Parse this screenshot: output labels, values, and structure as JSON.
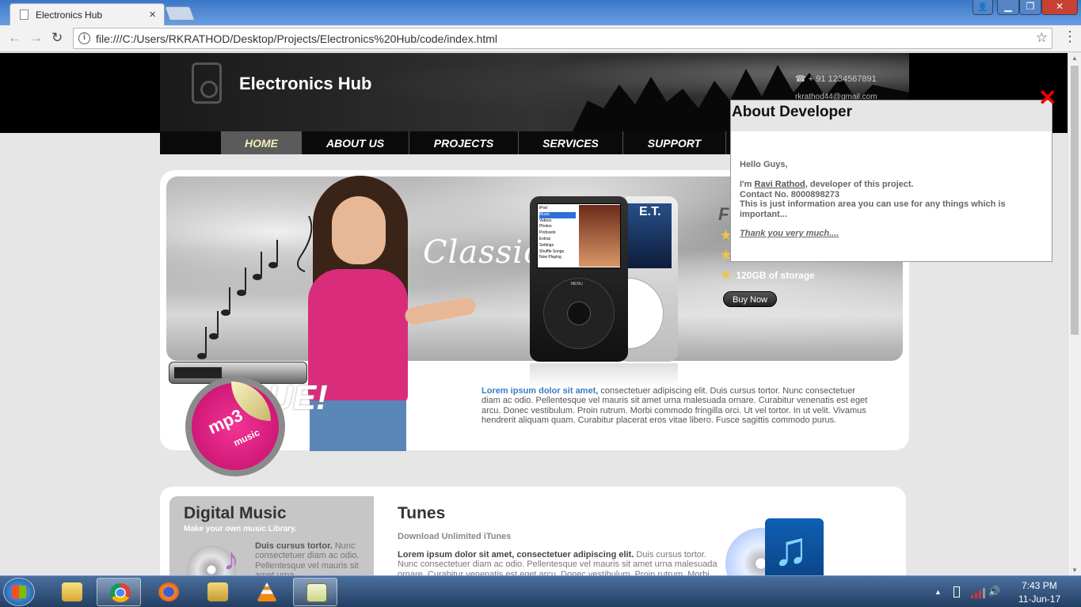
{
  "browser": {
    "tab_title": "Electronics Hub",
    "tab_close": "×",
    "url": "file:///C:/Users/RKRATHOD/Desktop/Projects/Electronics%20Hub/code/index.html",
    "back": "←",
    "forward": "→",
    "reload": "↻",
    "star": "☆",
    "menu": "⋮",
    "info_glyph": "i"
  },
  "window_controls": {
    "minimize": "▁",
    "maximize": "❐",
    "close": "✕",
    "user": "👤"
  },
  "header": {
    "site_title": "Electronics Hub",
    "phone": "☎   + 91 1234567891",
    "email": "rkrathod44@gmail.com"
  },
  "nav": {
    "items": [
      {
        "label": "HOME"
      },
      {
        "label": "ABOUT US"
      },
      {
        "label": "PROJECTS"
      },
      {
        "label": "SERVICES"
      },
      {
        "label": "SUPPORT"
      }
    ]
  },
  "banner": {
    "classic_script": "Classic",
    "feature_heading": "F",
    "features": [
      "",
      "",
      "120GB of storage"
    ],
    "buy_now": "Buy Now",
    "ipod_menu": [
      "iPod",
      "Music",
      "Videos",
      "Photos",
      "Podcasts",
      "Extras",
      "Settings",
      "Shuffle Songs",
      "Now Playing"
    ],
    "ipod_wheel_label": "MENU",
    "ipod_silver_title": "E.T.",
    "sticker_mp3": "mp3",
    "sticker_music": "music",
    "big_text": "UE!",
    "lorem_lead": "Lorem ipsum dolor sit amet,",
    "lorem_body": " consectetuer adipiscing elit. Duis cursus tortor. Nunc consectetuer diam ac odio. Pellentesque vel mauris sit amet urna malesuada ornare. Curabitur venenatis est eget arcu. Donec vestibulum. Proin rutrum. Morbi commodo fringilla orci. Ut vel tortor. In ut velit. Vivamus hendrerit aliquam quam. Curabitur placerat eros vitae libero. Fusce sagittis commodo purus."
  },
  "digital_music": {
    "heading": "Digital Music",
    "subheading": "Make your own music Library.",
    "text_lead": "Duis cursus tortor.",
    "text_body": " Nunc consectetuer diam ac odio. Pellentesque vel mauris sit amet urna"
  },
  "tunes": {
    "heading": "Tunes",
    "subheading": "Download Unlimited iTunes",
    "text_lead": "Lorem ipsum dolor sit amet, consectetuer adipiscing elit.",
    "text_body": " Duis cursus tortor. Nunc consectetuer diam ac odio. Pellentesque vel mauris sit amet urna malesuada ornare. Curabitur venenatis est eget arcu. Donec vestibulum. Proin rutrum. Morbi"
  },
  "popup": {
    "title": "About Developer",
    "close": "✕",
    "greeting": "Hello Guys,",
    "intro_prefix": "I'm ",
    "name": "Ravi Rathod",
    "intro_suffix": ", developer of this project.",
    "contact": "Contact No. 8000898273",
    "info": "This is just information area you can use for any things which is important...",
    "thanks": "Thank you very much...."
  },
  "taskbar": {
    "time": "7:43 PM",
    "date": "11-Jun-17",
    "tray_arrow": "▲",
    "volume": "🔊"
  },
  "colors": {
    "accent_link": "#3b7dc4",
    "nav_active_text": "#f5efb8",
    "sticker_pink": "#d9147f",
    "close_red": "#e00000"
  }
}
